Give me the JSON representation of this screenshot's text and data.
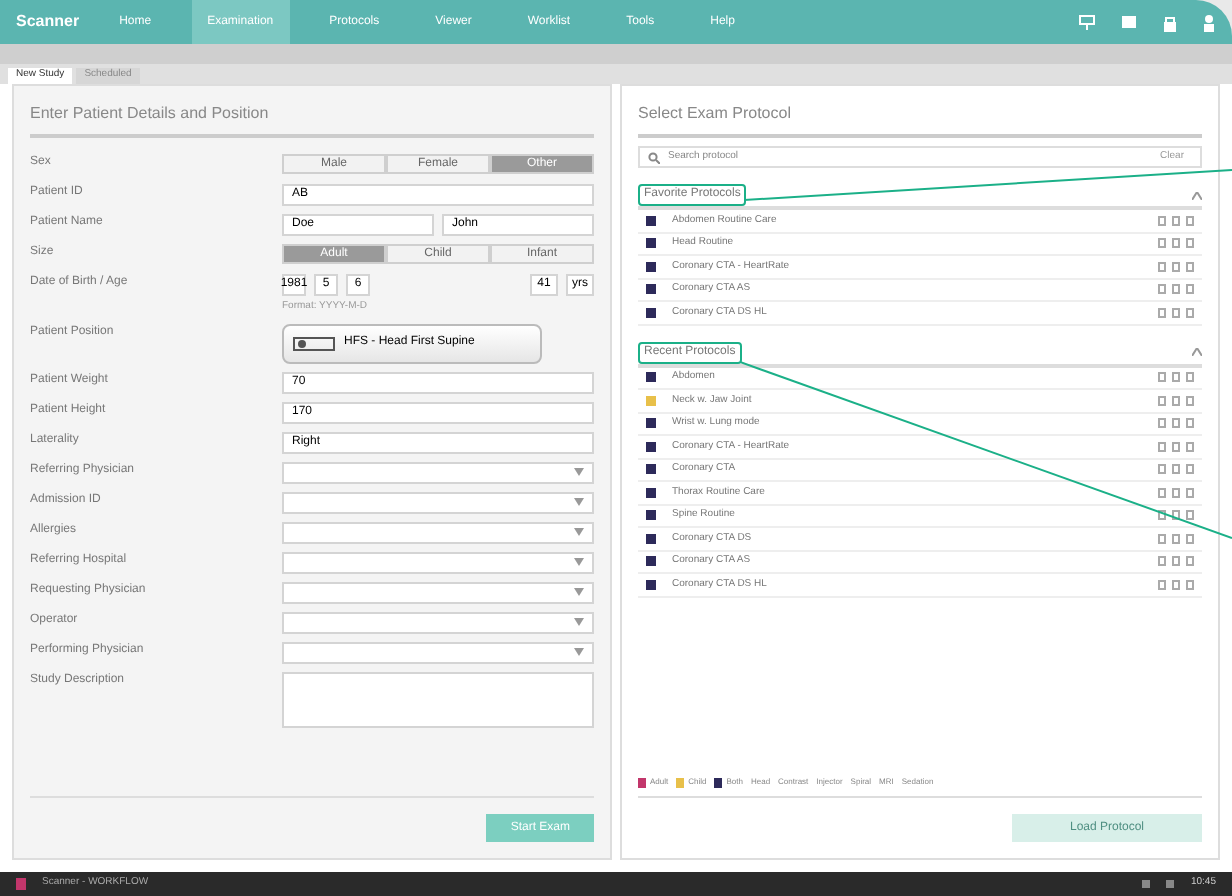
{
  "header": {
    "logo": "Scanner",
    "menu": [
      {
        "label": "Home",
        "selected": false
      },
      {
        "label": "Examination",
        "selected": true
      },
      {
        "label": "Protocols",
        "selected": false
      },
      {
        "label": "Viewer",
        "selected": false
      },
      {
        "label": "Worklist",
        "selected": false
      },
      {
        "label": "Tools",
        "selected": false
      },
      {
        "label": "Help",
        "selected": false
      }
    ]
  },
  "tabs": [
    {
      "label": "New Study",
      "selected": true
    },
    {
      "label": "Scheduled",
      "selected": false
    }
  ],
  "patient": {
    "title": "Enter Patient Details and Position",
    "rows": [
      {
        "kind": "segmented",
        "label": "Sex",
        "options": [
          {
            "label": "Male",
            "selected": false
          },
          {
            "label": "Female",
            "selected": false
          },
          {
            "label": "Other",
            "selected": true
          }
        ]
      },
      {
        "kind": "text",
        "label": "Patient ID",
        "value": "AB"
      },
      {
        "kind": "pair",
        "label": "Patient Name",
        "values": [
          "Doe",
          "John"
        ]
      },
      {
        "kind": "segmented",
        "label": "Size",
        "options": [
          {
            "label": "Adult",
            "selected": true
          },
          {
            "label": "Child",
            "selected": false
          },
          {
            "label": "Infant",
            "selected": false
          }
        ]
      },
      {
        "kind": "date",
        "label": "Date of Birth / Age",
        "values": [
          "1981",
          "5",
          "6"
        ],
        "age": "41",
        "unit": "yrs",
        "hint": "Format: YYYY-M-D"
      },
      {
        "kind": "position",
        "label": "Patient Position",
        "value": "HFS - Head First Supine"
      },
      {
        "kind": "text",
        "label": "Patient Weight",
        "value": "70"
      },
      {
        "kind": "text",
        "label": "Patient Height",
        "value": "170"
      },
      {
        "kind": "select",
        "label": "Laterality",
        "value": "Right"
      },
      {
        "kind": "combo",
        "label": "Referring Physician"
      },
      {
        "kind": "combo",
        "label": "Admission ID"
      },
      {
        "kind": "combo",
        "label": "Allergies"
      },
      {
        "kind": "combo",
        "label": "Referring Hospital"
      },
      {
        "kind": "combo",
        "label": "Requesting Physician"
      },
      {
        "kind": "combo",
        "label": "Operator"
      },
      {
        "kind": "combo",
        "label": "Performing Physician"
      },
      {
        "kind": "area",
        "label": "Study Description"
      }
    ],
    "button": "Start Exam"
  },
  "protocols": {
    "title": "Select Exam Protocol",
    "search": {
      "placeholder": "Search protocol",
      "button": "Clear"
    },
    "groups": [
      {
        "title": "Favorite Protocols",
        "items": [
          {
            "name": "Abdomen Routine Care",
            "color": "#2d2a5a"
          },
          {
            "name": "Head Routine",
            "color": "#2d2a5a"
          },
          {
            "name": "Coronary CTA - HeartRate",
            "color": "#2d2a5a"
          },
          {
            "name": "Coronary CTA AS",
            "color": "#2d2a5a"
          },
          {
            "name": "Coronary CTA DS HL",
            "color": "#2d2a5a"
          }
        ]
      },
      {
        "title": "Recent Protocols",
        "items": [
          {
            "name": "Abdomen",
            "color": "#2d2a5a"
          },
          {
            "name": "Neck w. Jaw Joint",
            "color": "#e8c04a"
          },
          {
            "name": "Wrist w. Lung mode",
            "color": "#2d2a5a"
          },
          {
            "name": "Coronary CTA - HeartRate",
            "color": "#2d2a5a"
          },
          {
            "name": "Coronary CTA",
            "color": "#2d2a5a"
          },
          {
            "name": "Thorax Routine Care",
            "color": "#2d2a5a"
          },
          {
            "name": "Spine Routine",
            "color": "#2d2a5a"
          },
          {
            "name": "Coronary CTA DS",
            "color": "#2d2a5a"
          },
          {
            "name": "Coronary CTA AS",
            "color": "#2d2a5a"
          },
          {
            "name": "Coronary CTA DS HL",
            "color": "#2d2a5a"
          }
        ]
      }
    ],
    "legend": [
      {
        "label": "Adult",
        "color": "#c2366b"
      },
      {
        "label": "Child",
        "color": "#e8c04a"
      },
      {
        "label": "Both",
        "color": "#2d2a5a"
      }
    ],
    "legend_notes": [
      "Head",
      "Contrast",
      "Injector",
      "Spiral",
      "MRI",
      "Sedation"
    ],
    "button": "Load Protocol"
  },
  "taskbar": {
    "app": "Scanner - WORKFLOW",
    "time": "10:45"
  }
}
